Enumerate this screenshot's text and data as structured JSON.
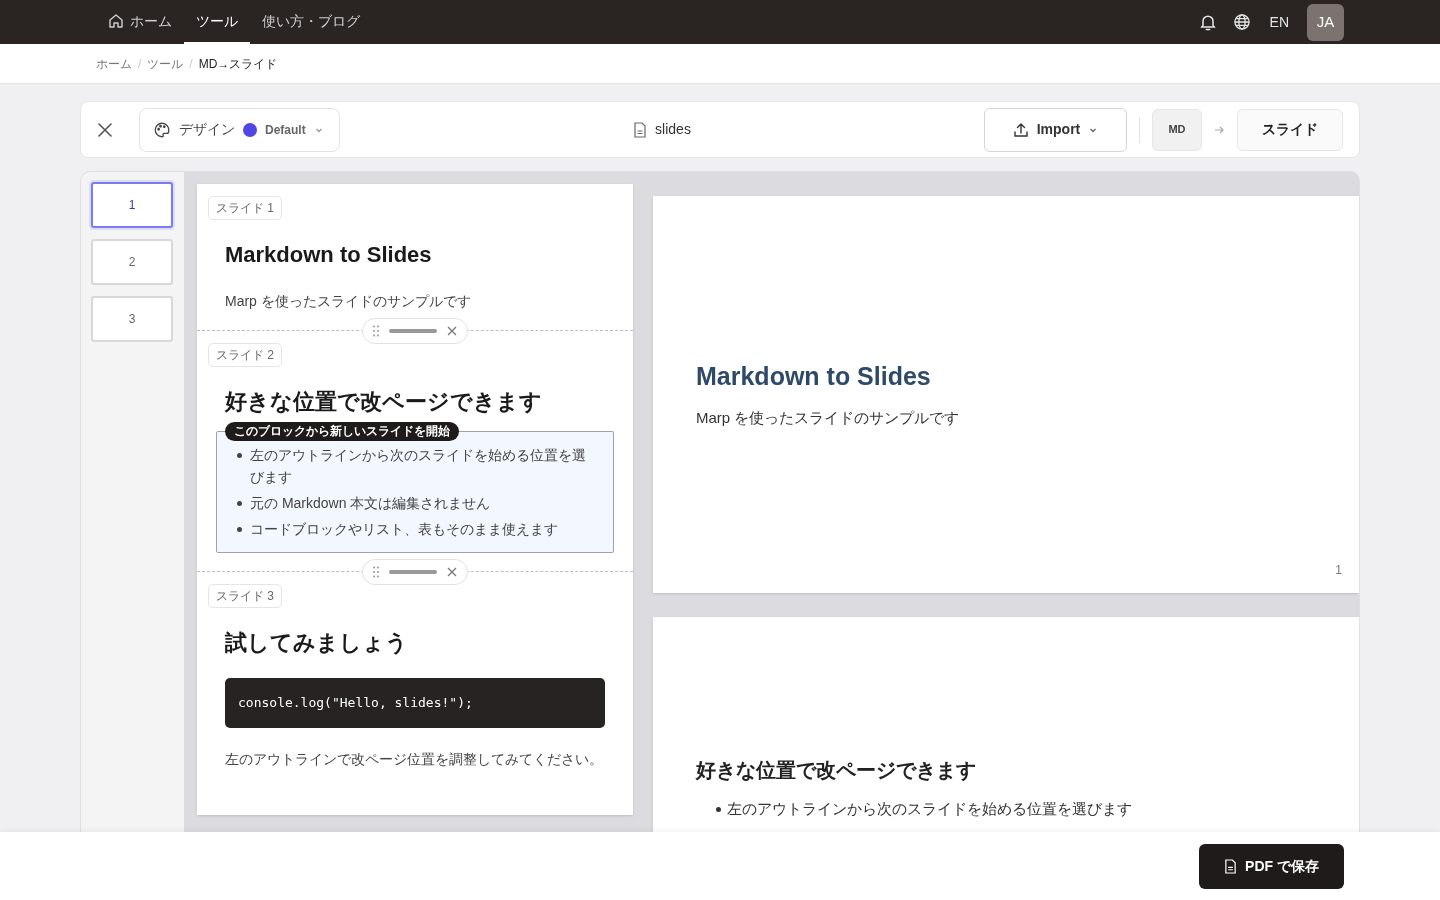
{
  "nav": {
    "items": [
      {
        "label": "ホーム",
        "kind": "home",
        "selected": false
      },
      {
        "label": "ツール",
        "kind": "plain",
        "selected": true
      },
      {
        "label": "使い方・ブログ",
        "kind": "plain",
        "selected": false
      }
    ],
    "language": "EN",
    "avatar": "JA"
  },
  "breadcrumb": [
    {
      "kind": "link",
      "text": "ホーム"
    },
    {
      "kind": "separator",
      "text": "/"
    },
    {
      "kind": "link",
      "text": "ツール"
    },
    {
      "kind": "separator",
      "text": "/"
    },
    {
      "kind": "current",
      "text": "MD→スライド"
    }
  ],
  "toolbar": {
    "design_label": "デザイン",
    "theme": {
      "name": "Default",
      "color": "#4f46e5"
    },
    "file_name": "slides",
    "import_button": "Import",
    "from": "MD",
    "to": "スライド"
  },
  "thumbnails": [
    {
      "label": "1",
      "selected": true
    },
    {
      "label": "2",
      "selected": false
    },
    {
      "label": "3",
      "selected": false
    }
  ],
  "outline": [
    {
      "badge": "スライド 1",
      "blocks": [
        {
          "kind": "heading",
          "text": "Markdown to Slides"
        },
        {
          "kind": "paragraph",
          "text": "Marp を使ったスライドのサンプルです"
        }
      ]
    },
    {
      "badge": "スライド 2",
      "blocks": [
        {
          "kind": "heading",
          "text": "好きな位置で改ページできます"
        },
        {
          "kind": "list",
          "highlighted": true,
          "tooltip": "このブロックから新しいスライドを開始",
          "items": [
            "左のアウトラインから次のスライドを始める位置を選びます",
            "元の Markdown 本文は編集されません",
            "コードブロックやリスト、表もそのまま使えます"
          ]
        }
      ]
    },
    {
      "badge": "スライド 3",
      "blocks": [
        {
          "kind": "heading",
          "text": "試してみましょう"
        },
        {
          "kind": "code",
          "text": "console.log(\"Hello, slides!\");"
        },
        {
          "kind": "paragraph",
          "text": "左のアウトラインで改ページ位置を調整してみてください。"
        }
      ]
    }
  ],
  "preview": [
    {
      "blocks": [
        {
          "kind": "title",
          "text": "Markdown to Slides"
        },
        {
          "kind": "paragraph",
          "text": "Marp を使ったスライドのサンプルです"
        }
      ],
      "page_number": "1"
    },
    {
      "blocks": [
        {
          "kind": "heading",
          "text": "好きな位置で改ページできます"
        },
        {
          "kind": "list",
          "items": [
            "左のアウトラインから次のスライドを始める位置を選びます"
          ]
        }
      ]
    }
  ],
  "save_button": "PDF で保存"
}
